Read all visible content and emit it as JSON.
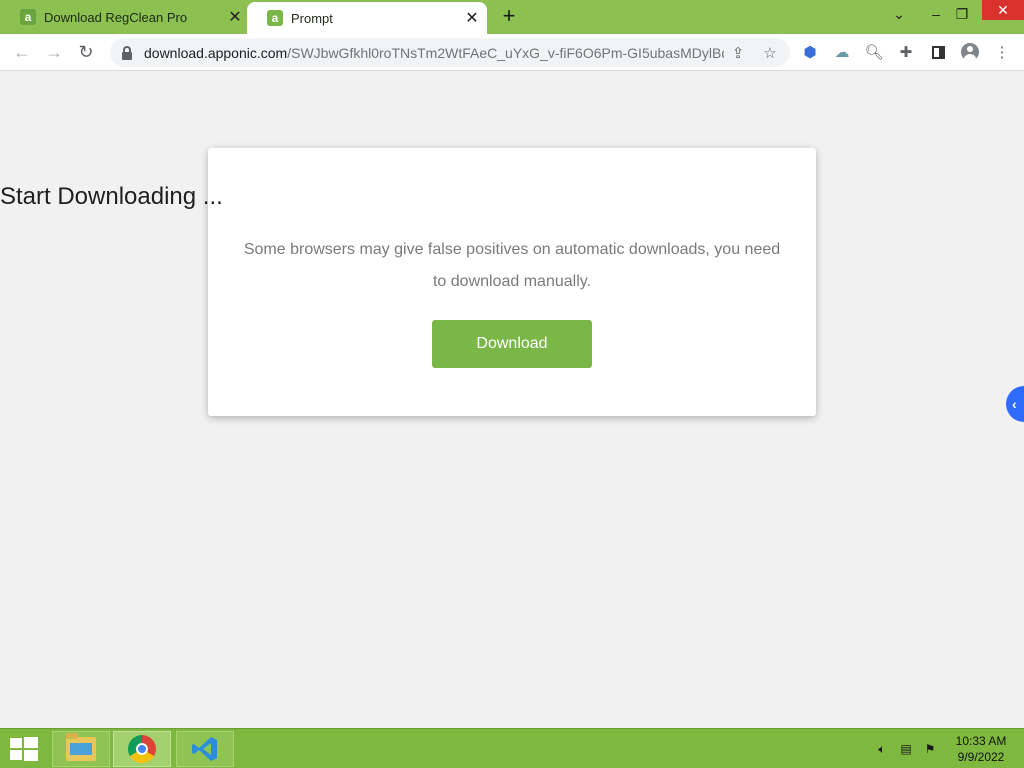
{
  "browser": {
    "tabs": [
      {
        "title": "Download RegClean Pro",
        "favicon": "a",
        "active": false
      },
      {
        "title": "Prompt",
        "favicon": "a",
        "active": true
      }
    ],
    "new_tab_label": "+",
    "url": {
      "host": "download.apponic.com",
      "path": "/SWJbwGfkhl0roTNsTm2WtFAeC_uYxG_v-fiF6O6Pm-GI5ubasMDylBd..."
    },
    "icons": {
      "back": "arrow-left-icon",
      "forward": "arrow-right-icon",
      "reload": "reload-icon",
      "lock": "lock-icon",
      "share": "share-icon",
      "bookmark": "star-icon",
      "extensions": [
        "cube-extension-icon",
        "cloud-extension-icon",
        "zoom-icon",
        "puzzle-icon",
        "side-panel-icon",
        "profile-icon",
        "menu-icon"
      ]
    }
  },
  "page": {
    "title": "Start Downloading ...",
    "message": "Some browsers may give false positives on automatic downloads, you need to download manually.",
    "download_button": "Download",
    "side_tab_icon": "chevron-left-icon"
  },
  "taskbar": {
    "clock_time": "10:33 AM",
    "clock_date": "9/9/2022",
    "apps": [
      "file-explorer-icon",
      "chrome-icon",
      "vscode-icon"
    ]
  },
  "colors": {
    "tabstrip": "#8cc152",
    "accent": "#7ab648",
    "taskbar": "#7eb83f",
    "side_tab": "#2f6bff"
  }
}
